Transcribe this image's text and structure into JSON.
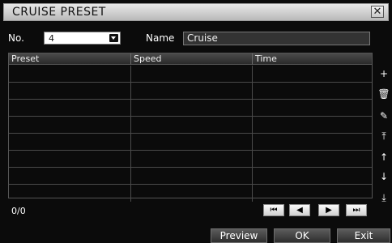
{
  "dialog": {
    "title": "CRUISE PRESET",
    "close_glyph": "✕"
  },
  "fields": {
    "no_label": "No.",
    "no_value": "4",
    "name_label": "Name",
    "name_value": "Cruise"
  },
  "table": {
    "columns": [
      "Preset",
      "Speed",
      "Time"
    ],
    "rows": [
      [
        "",
        "",
        ""
      ],
      [
        "",
        "",
        ""
      ],
      [
        "",
        "",
        ""
      ],
      [
        "",
        "",
        ""
      ],
      [
        "",
        "",
        ""
      ],
      [
        "",
        "",
        ""
      ],
      [
        "",
        "",
        ""
      ],
      [
        "",
        "",
        ""
      ]
    ]
  },
  "side_buttons": [
    {
      "icon": "plus-icon",
      "glyph": "+"
    },
    {
      "icon": "trash-icon",
      "glyph": "🗑"
    },
    {
      "icon": "pencil-icon",
      "glyph": "✎"
    },
    {
      "icon": "move-top-icon",
      "glyph": "⤒"
    },
    {
      "icon": "move-up-icon",
      "glyph": "↑"
    },
    {
      "icon": "move-down-icon",
      "glyph": "↓"
    },
    {
      "icon": "move-bottom-icon",
      "glyph": "⤓"
    }
  ],
  "pagination": {
    "count": "0/0",
    "first": "⏮",
    "prev": "◀",
    "next": "▶",
    "last": "⏭"
  },
  "actions": {
    "preview": "Preview",
    "ok": "OK",
    "exit": "Exit"
  }
}
